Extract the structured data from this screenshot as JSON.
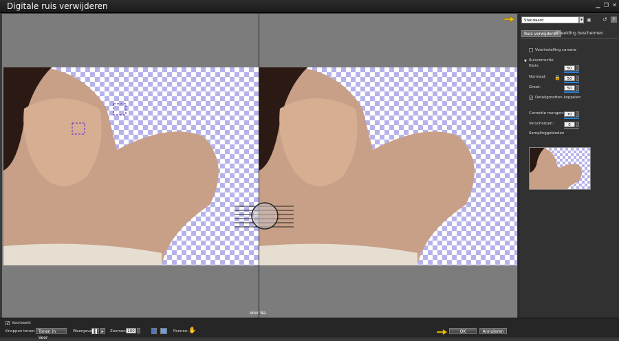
{
  "window": {
    "title": "Digitale ruis verwijderen"
  },
  "preview": {
    "split_label": "Voor Na"
  },
  "panel": {
    "preset_value": "Standaard",
    "tabs": [
      {
        "label": "Ruis verwijderen",
        "active": true
      },
      {
        "label": "Afbeelding beschermen",
        "active": false
      }
    ],
    "camera_checkbox_label": "Voorinstelling camera",
    "section_title": "Ruiscorrectie",
    "klein_label": "Klein:",
    "klein_value": "50",
    "normaal_label": "Normaal:",
    "normaal_value": "50",
    "groot_label": "Groot:",
    "groot_value": "50",
    "link_label": "Detailgrootten koppelen",
    "correction_label": "Correctie mengen:",
    "correction_value": "70",
    "sharpen_label": "Verscherpen:",
    "sharpen_value": "0",
    "sampling_label": "Samplinggebieden"
  },
  "bottom": {
    "preview_label": "Voorbeeld",
    "buttons_show_label": "Knoppen tonen:",
    "buttons_show_value": "Tonen in Voor",
    "view_label": "Weergave:",
    "zoom_label": "Zoomen:",
    "zoom_value": "100",
    "pan_label": "Pannen:",
    "ok_label": "OK",
    "cancel_label": "Annuleren"
  },
  "colors": {
    "accent": "#2a7fd8",
    "checker": "#b6b3ea",
    "hand": "#f2c200"
  }
}
